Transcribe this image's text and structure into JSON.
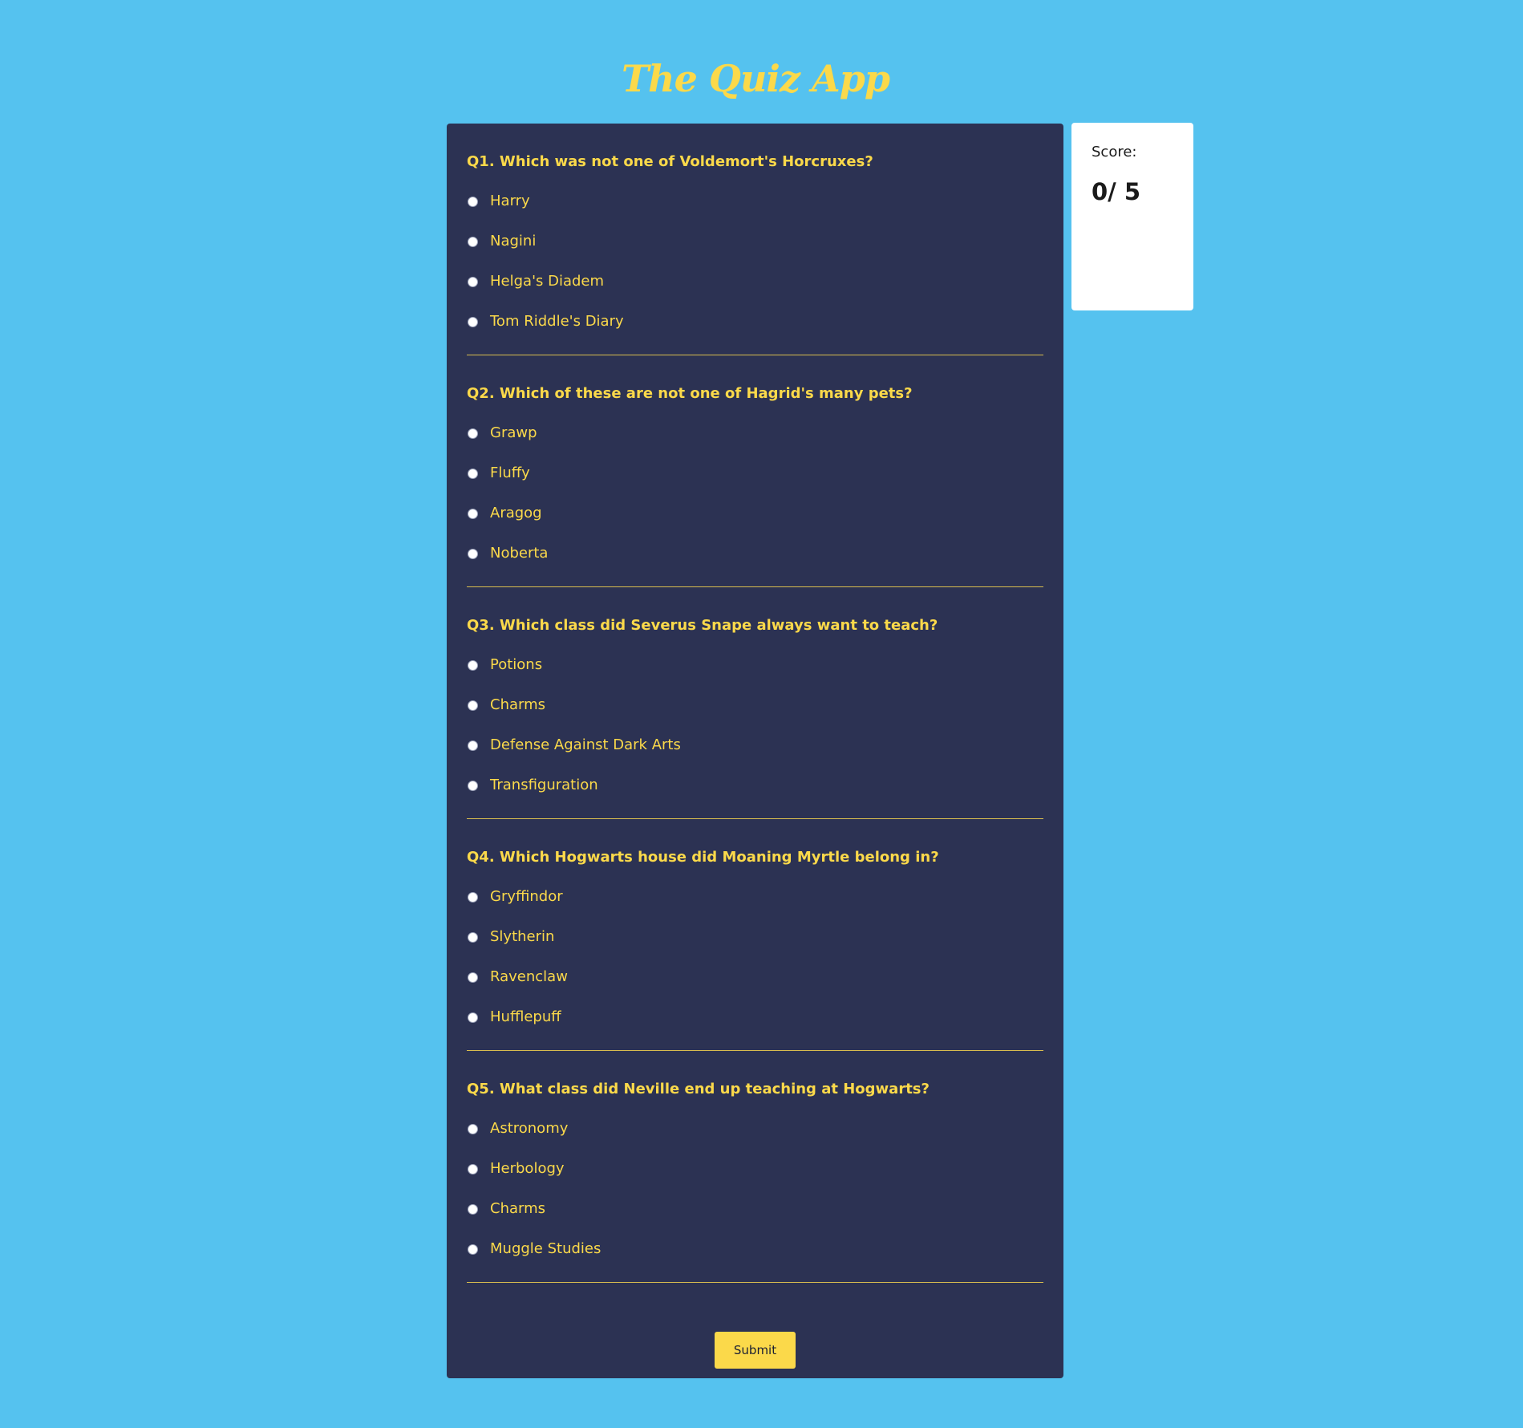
{
  "app": {
    "title": "The Quiz App"
  },
  "colors": {
    "background": "#55c2ef",
    "card": "#2c3253",
    "accent": "#fbd94a",
    "divider": "#d9bd4f",
    "score_card": "#ffffff"
  },
  "questions": [
    {
      "title": "Q1. Which was not one of Voldemort's Horcruxes?",
      "answers": [
        "Harry",
        "Nagini",
        "Helga's Diadem",
        "Tom Riddle's Diary"
      ]
    },
    {
      "title": "Q2. Which of these are not one of Hagrid's many pets?",
      "answers": [
        "Grawp",
        "Fluffy",
        "Aragog",
        "Noberta"
      ]
    },
    {
      "title": "Q3. Which class did Severus Snape always want to teach?",
      "answers": [
        "Potions",
        "Charms",
        "Defense Against Dark Arts",
        "Transfiguration"
      ]
    },
    {
      "title": "Q4. Which Hogwarts house did Moaning Myrtle belong in?",
      "answers": [
        "Gryffindor",
        "Slytherin",
        "Ravenclaw",
        "Hufflepuff"
      ]
    },
    {
      "title": "Q5. What class did Neville end up teaching at Hogwarts?",
      "answers": [
        "Astronomy",
        "Herbology",
        "Charms",
        "Muggle Studies"
      ]
    }
  ],
  "submit": {
    "label": "Submit"
  },
  "score": {
    "label": "Score:",
    "value": "0/ 5"
  }
}
